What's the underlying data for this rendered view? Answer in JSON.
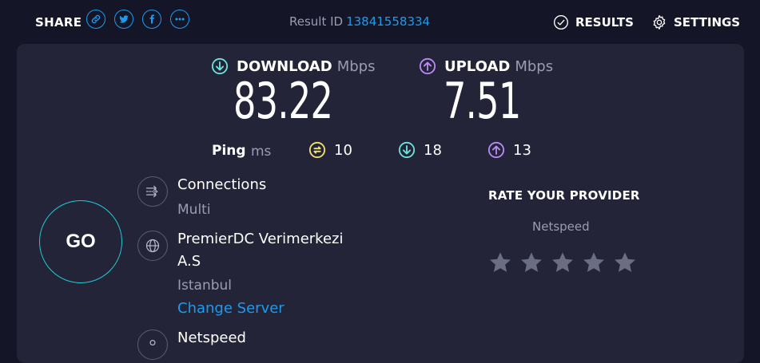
{
  "share": {
    "label": "SHARE",
    "buttons": [
      "link-icon",
      "twitter-icon",
      "facebook-icon",
      "more-icon"
    ]
  },
  "result": {
    "label": "Result ID",
    "id": "13841558334"
  },
  "nav": {
    "results": "RESULTS",
    "settings": "SETTINGS"
  },
  "download": {
    "label": "DOWNLOAD",
    "unit": "Mbps",
    "value": "83.22",
    "color": "#6be3da"
  },
  "upload": {
    "label": "UPLOAD",
    "unit": "Mbps",
    "value": "7.51",
    "color": "#b98af5"
  },
  "ping": {
    "label": "Ping",
    "unit": "ms",
    "idle": "10",
    "download": "18",
    "upload": "13",
    "idle_color": "#f2e26c"
  },
  "go": {
    "label": "GO"
  },
  "connections": {
    "title": "Connections",
    "value": "Multi"
  },
  "server": {
    "name_line1": "PremierDC Verimerkezi",
    "name_line2": "A.S",
    "location": "Istanbul",
    "change_link": "Change Server"
  },
  "isp": {
    "name": "Netspeed"
  },
  "rate": {
    "title": "RATE YOUR PROVIDER",
    "provider": "Netspeed",
    "stars": 5,
    "rating": 0
  }
}
